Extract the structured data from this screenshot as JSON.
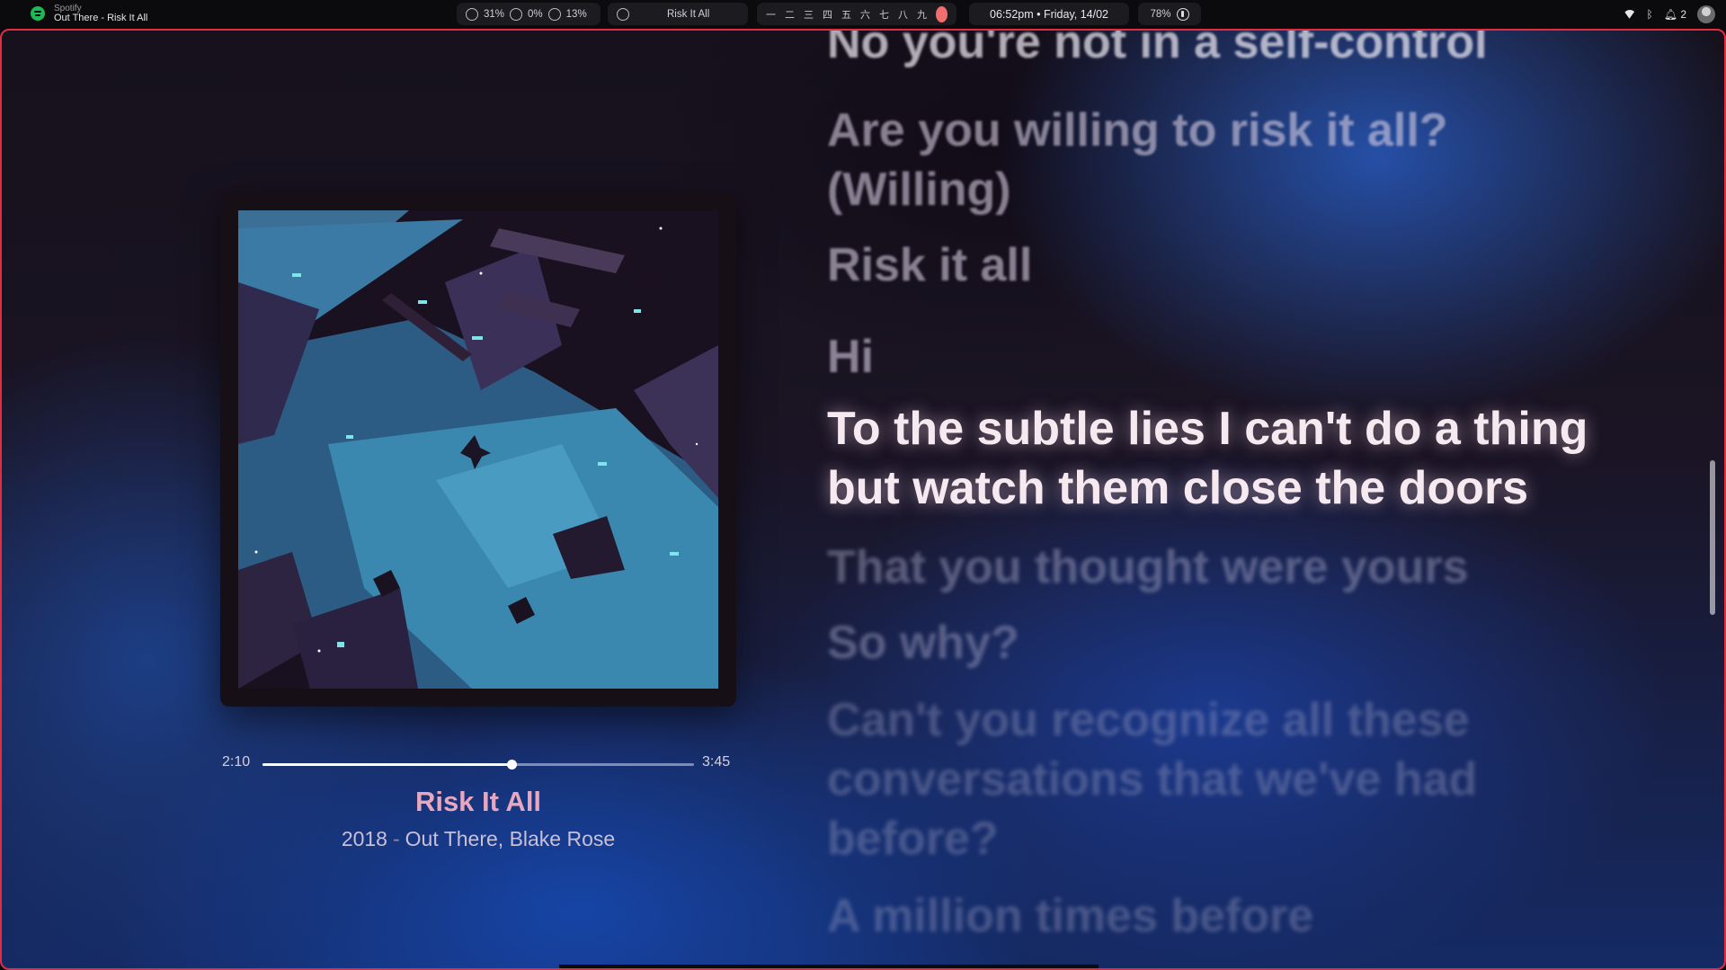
{
  "topbar": {
    "app_name": "Spotify",
    "now_playing": "Out There - Risk It All",
    "stats": {
      "cpu": "31%",
      "gpu": "0%",
      "mem": "13%"
    },
    "track_pill": "Risk It All",
    "workspaces": [
      "一",
      "二",
      "三",
      "四",
      "五",
      "六",
      "七",
      "八",
      "九"
    ],
    "clock": "06:52pm • Friday, 14/02",
    "battery": "78%",
    "notifications": "2"
  },
  "player": {
    "current_time": "2:10",
    "total_time": "3:45",
    "progress": 0.578,
    "title": "Risk It All",
    "year": "2018",
    "separator": "-",
    "artists": "Out There, Blake Rose"
  },
  "lyrics": {
    "lines": [
      "No you're not in a self-control",
      "Are you willing to risk it all? (Willing)",
      "Risk it all",
      "Hi",
      "To the subtle lies I can't do a thing but watch them close the doors",
      "That you thought were yours",
      "So why?",
      "Can't you recognize all these conversations that we've had before?",
      "A million times before"
    ]
  },
  "colors": {
    "window_border": "#e12d3f",
    "title_pink": "#e7a7bf",
    "spotify_green": "#1db954"
  }
}
